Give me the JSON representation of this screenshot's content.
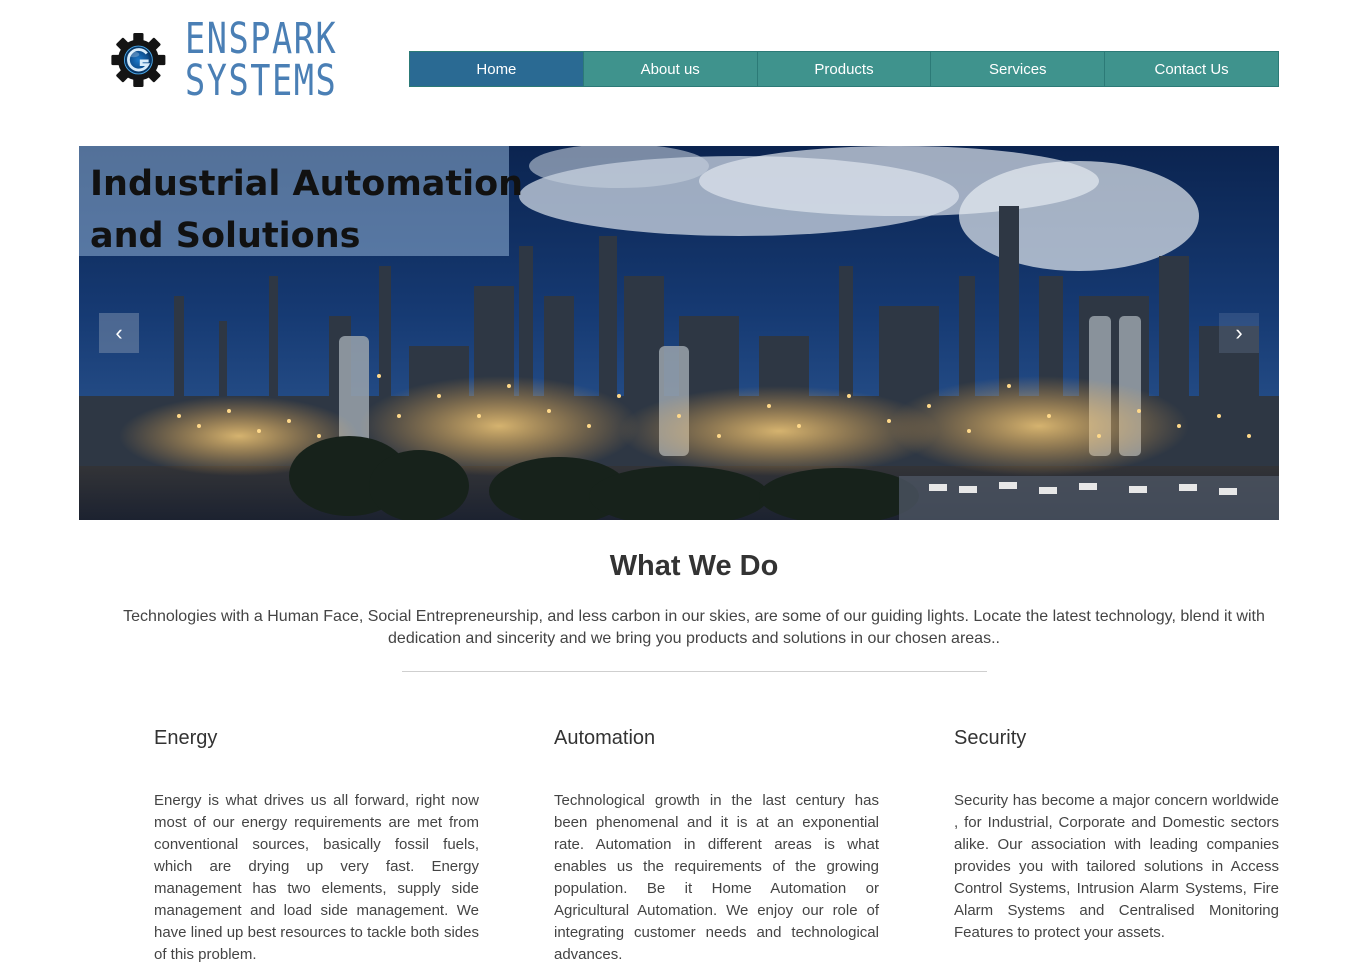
{
  "brand": {
    "name_line1": "ENSPARK",
    "name_line2": "SYSTEMS",
    "logo_icon": "gear-icon",
    "color": "#4a7fb5"
  },
  "nav": {
    "items": [
      {
        "label": "Home",
        "active": true
      },
      {
        "label": "About us",
        "active": false
      },
      {
        "label": "Products",
        "active": false
      },
      {
        "label": "Services",
        "active": false
      },
      {
        "label": "Contact Us",
        "active": false
      }
    ],
    "colors": {
      "default": "#3f938d",
      "active": "#2a6a93"
    }
  },
  "carousel": {
    "caption_line1": "Industrial Automation",
    "caption_line2": "and Solutions",
    "prev_icon": "chevron-left-icon",
    "next_icon": "chevron-right-icon",
    "prev_glyph": "‹",
    "next_glyph": "›"
  },
  "what_we_do": {
    "title": "What We Do",
    "text": "Technologies with a Human Face, Social Entrepreneurship, and less carbon in our skies, are some of our guiding lights. Locate the latest technology, blend it with dedication and sincerity and we bring you products and solutions in our chosen areas.."
  },
  "features": [
    {
      "title": "Energy",
      "text": "Energy is what drives us all forward, right now most of our energy requirements are met from conventional sources, basically fossil fuels, which are drying up very fast. Energy management has two elements, supply side management and load side management. We have lined up best resources to tackle both sides of this problem."
    },
    {
      "title": "Automation",
      "text": "Technological growth in the last century has been phenomenal and it is at an exponential rate. Automation in different areas is what enables us the requirements of the growing population. Be it Home Automation or Agricultural Automation. We enjoy our role of integrating customer needs and technological advances."
    },
    {
      "title": "Security",
      "text": "Security has become a major concern worldwide , for Industrial, Corporate and Domestic sectors alike. Our association with leading companies provides you with tailored solutions in Access Control Systems, Intrusion Alarm Systems, Fire Alarm Systems and Centralised Monitoring Features to protect your assets."
    }
  ]
}
